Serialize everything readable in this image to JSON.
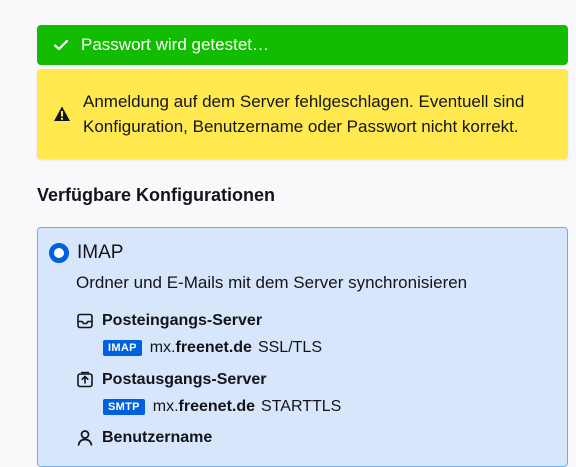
{
  "banners": {
    "success": {
      "text": "Passwort wird getestet…",
      "icon": "checkmark-icon",
      "color": "#12bc00"
    },
    "warning": {
      "text": "Anmeldung auf dem Server fehlgeschlagen. Eventuell sind Konfiguration, Benutzername oder Passwort nicht korrekt.",
      "icon": "warning-icon",
      "color": "#ffe94e"
    }
  },
  "section": {
    "title": "Verfügbare Konfigurationen"
  },
  "config": {
    "title": "IMAP",
    "description": "Ordner und E-Mails mit dem Server synchronisieren",
    "incoming": {
      "label": "Posteingangs-Server",
      "protocol": "IMAP",
      "host_prefix": "mx.",
      "host_domain": "freenet.de",
      "security": "SSL/TLS"
    },
    "outgoing": {
      "label": "Postausgangs-Server",
      "protocol": "SMTP",
      "host_prefix": "mx.",
      "host_domain": "freenet.de",
      "security": "STARTTLS"
    },
    "username": {
      "label": "Benutzername"
    }
  },
  "colors": {
    "accent": "#0061e0",
    "selected_bg": "#d7e6fb"
  }
}
